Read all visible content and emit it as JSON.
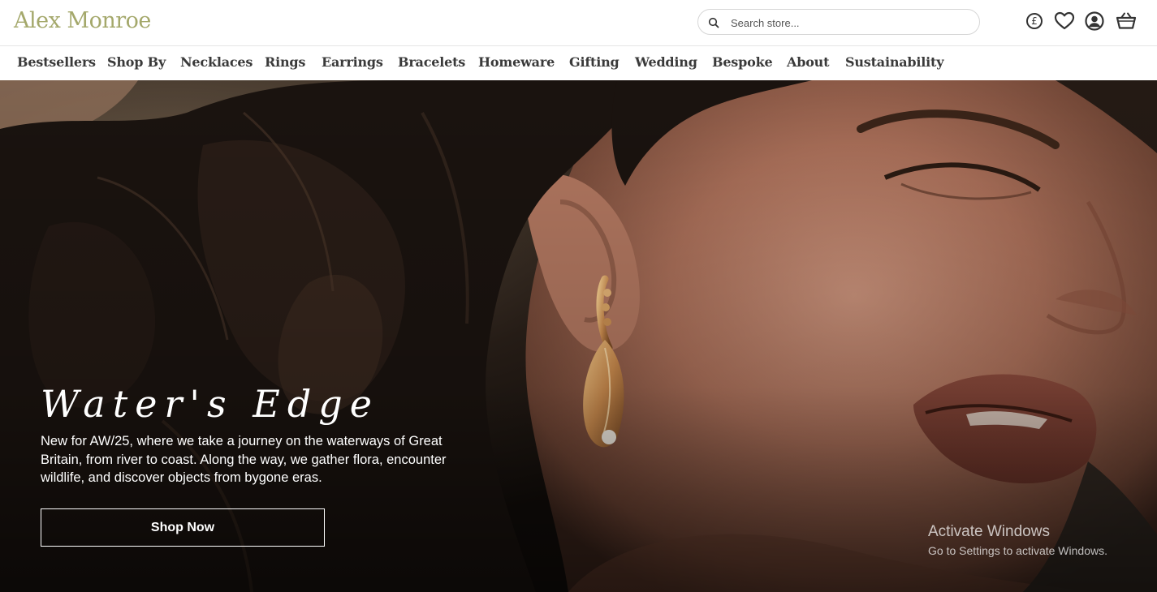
{
  "header": {
    "logo_text": "Alex Monroe",
    "search_placeholder": "Search store...",
    "currency_symbol": "£",
    "icons": [
      "currency-icon",
      "heart-icon",
      "account-icon",
      "basket-icon"
    ]
  },
  "nav": {
    "items": [
      {
        "label": "Bestsellers"
      },
      {
        "label": "Shop By"
      },
      {
        "label": "Necklaces"
      },
      {
        "label": "Rings"
      },
      {
        "label": "Earrings"
      },
      {
        "label": "Bracelets"
      },
      {
        "label": "Homeware"
      },
      {
        "label": "Gifting"
      },
      {
        "label": "Wedding"
      },
      {
        "label": "Bespoke"
      },
      {
        "label": "About"
      },
      {
        "label": "Sustainability"
      }
    ]
  },
  "hero": {
    "title": "Water's Edge",
    "description": "New for AW/25, where we take a journey on the waterways of Great Britain, from river to coast. Along the way, we gather flora, encounter wildlife, and discover objects from bygone eras.",
    "cta_label": "Shop Now"
  },
  "watermark": {
    "title": "Activate Windows",
    "subtitle": "Go to Settings to activate Windows."
  },
  "colors": {
    "logo": "#a4a86b",
    "nav_text": "#3a3a3a",
    "hero_text": "#ffffff"
  }
}
